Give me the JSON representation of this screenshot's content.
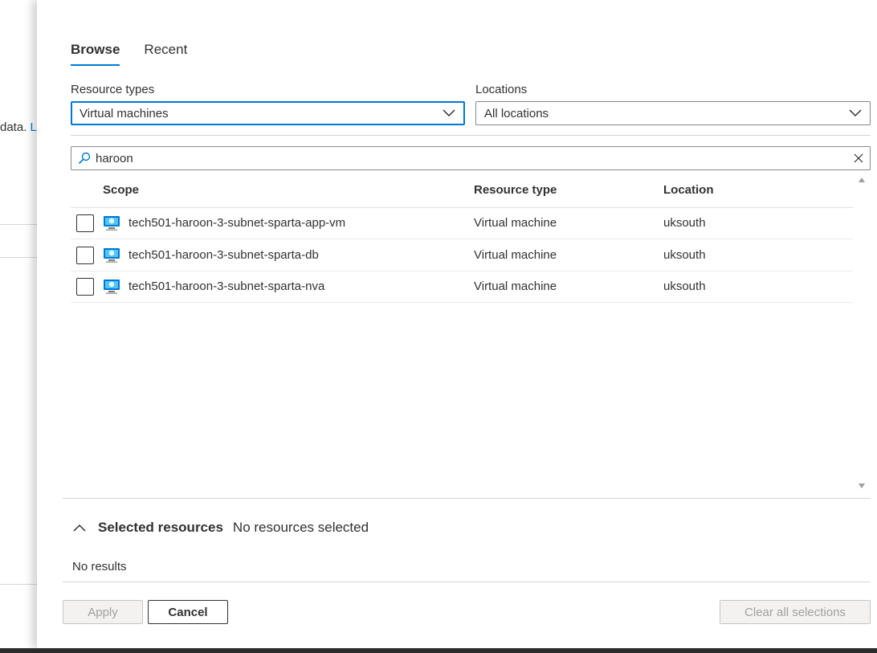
{
  "background_page": {
    "text_fragment": "data.",
    "link_fragment": "Lo"
  },
  "tabs": [
    {
      "label": "Browse",
      "active": true
    },
    {
      "label": "Recent",
      "active": false
    }
  ],
  "filters": {
    "resource_types_label": "Resource types",
    "resource_types_value": "Virtual machines",
    "locations_label": "Locations",
    "locations_value": "All locations"
  },
  "search": {
    "value": "haroon"
  },
  "table": {
    "headers": {
      "scope": "Scope",
      "resource_type": "Resource type",
      "location": "Location"
    },
    "rows": [
      {
        "scope": "tech501-haroon-3-subnet-sparta-app-vm",
        "resource_type": "Virtual machine",
        "location": "uksouth",
        "icon": "virtual-machine-icon"
      },
      {
        "scope": "tech501-haroon-3-subnet-sparta-db",
        "resource_type": "Virtual machine",
        "location": "uksouth",
        "icon": "virtual-machine-icon"
      },
      {
        "scope": "tech501-haroon-3-subnet-sparta-nva",
        "resource_type": "Virtual machine",
        "location": "uksouth",
        "icon": "virtual-machine-icon"
      }
    ]
  },
  "selected": {
    "title": "Selected resources",
    "status": "No resources selected",
    "empty_text": "No results"
  },
  "buttons": {
    "apply": "Apply",
    "cancel": "Cancel",
    "clear": "Clear all selections"
  },
  "colors": {
    "accent": "#0078d4",
    "text": "#323130",
    "disabled_bg": "#f3f2f1",
    "disabled_text": "#a19f9d"
  }
}
